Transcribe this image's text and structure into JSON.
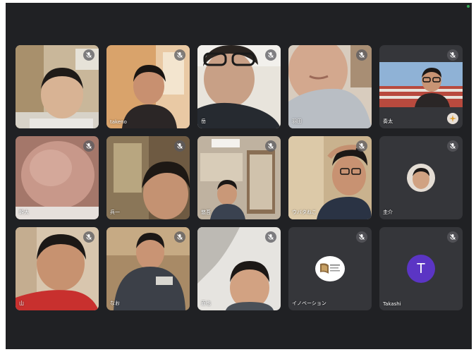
{
  "colors": {
    "background": "#202124",
    "tile": "#3c4043",
    "tile_empty": "#35363a",
    "avatar_accent": "#5b35c4",
    "status_dot": "#34a853"
  },
  "icons": {
    "mute": "mic-off-icon",
    "badge": "sparkle-badge-icon"
  },
  "participants": [
    {
      "name": ""
    },
    {
      "name": "takeno"
    },
    {
      "name": "岳"
    },
    {
      "name": "羽田"
    },
    {
      "name": "奏太"
    },
    {
      "name": "幹大"
    },
    {
      "name": "兵一"
    },
    {
      "name": "悠吾"
    },
    {
      "name": "ウバタねこ"
    },
    {
      "name": "圭介"
    },
    {
      "name": "山"
    },
    {
      "name": "なお"
    },
    {
      "name": "直也"
    },
    {
      "name": "イノベーション"
    },
    {
      "name": "Takashi",
      "initial": "T"
    }
  ]
}
